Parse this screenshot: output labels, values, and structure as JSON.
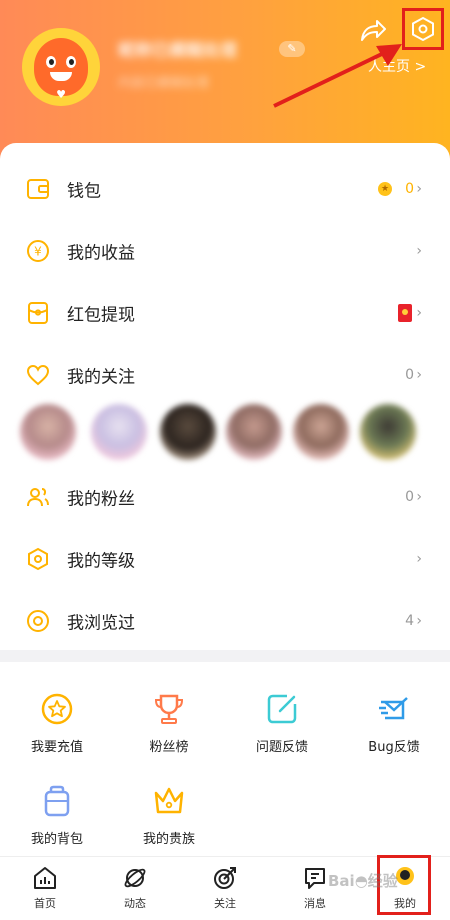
{
  "profile": {
    "username": "昵称已模糊处理",
    "subline": "内容已模糊处理",
    "homepage_link": "人主页 >"
  },
  "menu": {
    "wallet": {
      "label": "钱包",
      "value": "0"
    },
    "earnings": {
      "label": "我的收益"
    },
    "redpacket": {
      "label": "红包提现"
    },
    "following": {
      "label": "我的关注",
      "value": "0"
    },
    "fans": {
      "label": "我的粉丝",
      "value": "0"
    },
    "level": {
      "label": "我的等级"
    },
    "history": {
      "label": "我浏览过",
      "value": "4"
    }
  },
  "grid": {
    "recharge": "我要充值",
    "fan_rank": "粉丝榜",
    "feedback": "问题反馈",
    "bug_feedback": "Bug反馈",
    "backpack": "我的背包",
    "nobility": "我的贵族"
  },
  "tabs": {
    "home": "首页",
    "moments": "动态",
    "follow": "关注",
    "messages": "消息",
    "me": "我的"
  },
  "watermark": "Bai◓经验",
  "colors": {
    "accent": "#ffb300",
    "header_start": "#ff8a57",
    "header_end": "#ffb420",
    "annotation": "#e2201b"
  }
}
